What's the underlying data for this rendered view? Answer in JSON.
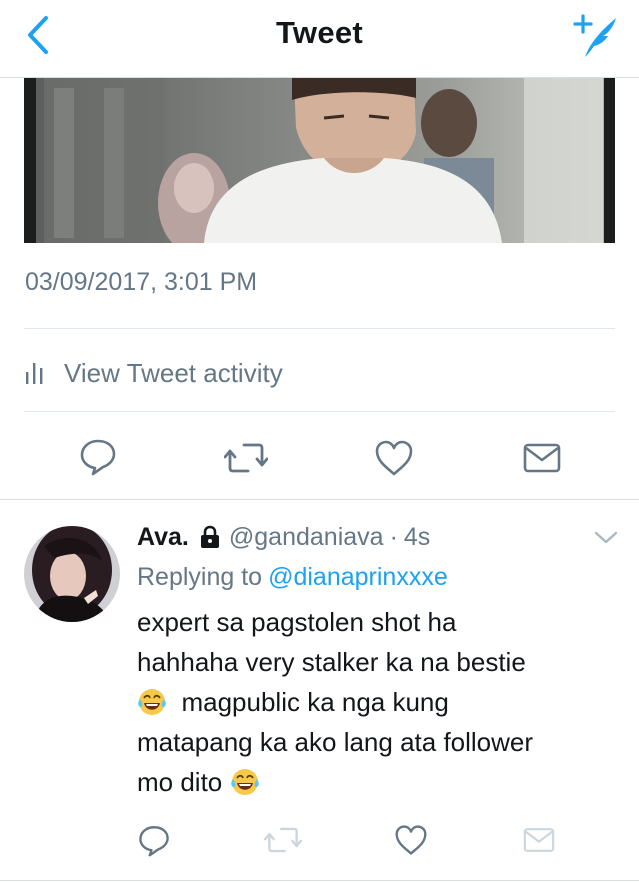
{
  "header": {
    "title": "Tweet",
    "back_icon": "chevron-left-icon",
    "compose_icon": "compose-tweet-icon",
    "accent_color": "#1da1f2"
  },
  "tweet": {
    "timestamp": "03/09/2017, 3:01 PM",
    "activity_label": "View Tweet activity",
    "actions": [
      "reply-icon",
      "retweet-icon",
      "like-icon",
      "direct-message-icon"
    ]
  },
  "reply": {
    "name": "Ava.",
    "handle": "@gandaniava",
    "separator": "·",
    "time": "4s",
    "replying_prefix": "Replying to",
    "replying_to": "@dianaprinxxxe",
    "line1": "expert sa pagstolen shot ha",
    "line2": "hahhaha very stalker ka na bestie",
    "line3": "magpublic ka nga kung",
    "line4": "matapang ka ako lang ata follower",
    "line5": "mo dito",
    "emoji": "face-with-tears-of-joy",
    "actions": [
      "reply-icon",
      "retweet-icon",
      "like-icon",
      "direct-message-icon"
    ]
  }
}
